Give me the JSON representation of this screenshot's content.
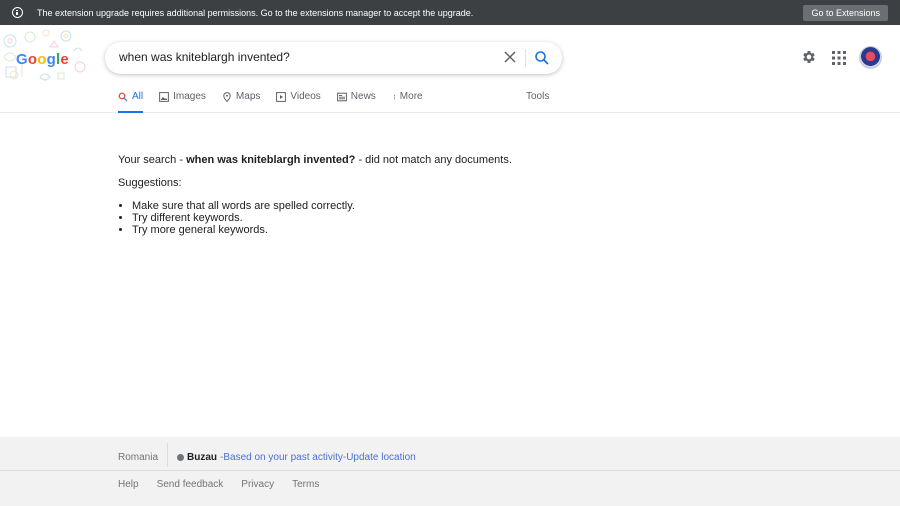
{
  "extension_bar": {
    "message": "The extension upgrade requires additional permissions. Go to the extensions manager to accept the upgrade.",
    "button_label": "Go to Extensions"
  },
  "header": {
    "logo_text": "Google",
    "query": "when was kniteblargh invented?"
  },
  "tabs": [
    {
      "label": "All",
      "icon": "search-icon",
      "active": true
    },
    {
      "label": "Images",
      "icon": "image-icon"
    },
    {
      "label": "Maps",
      "icon": "map-pin-icon"
    },
    {
      "label": "Videos",
      "icon": "video-icon"
    },
    {
      "label": "News",
      "icon": "news-icon"
    },
    {
      "label": "More",
      "icon": "more-vert-icon"
    }
  ],
  "tools_label": "Tools",
  "results": {
    "prefix": "Your search - ",
    "query": "when was kniteblargh invented?",
    "suffix": " - did not match any documents.",
    "suggestions_heading": "Suggestions:",
    "suggestions": [
      "Make sure that all words are spelled correctly.",
      "Try different keywords.",
      "Try more general keywords."
    ]
  },
  "footer": {
    "country": "Romania",
    "city": "Buzau",
    "dash1": " - ",
    "activity_link": "Based on your past activity",
    "dash2": " - ",
    "update_link": "Update location",
    "links": [
      "Help",
      "Send feedback",
      "Privacy",
      "Terms"
    ]
  },
  "colors": {
    "accent": "#1a73e8",
    "ext_bar": "#3c4043",
    "footer_bg": "#f2f2f2"
  }
}
